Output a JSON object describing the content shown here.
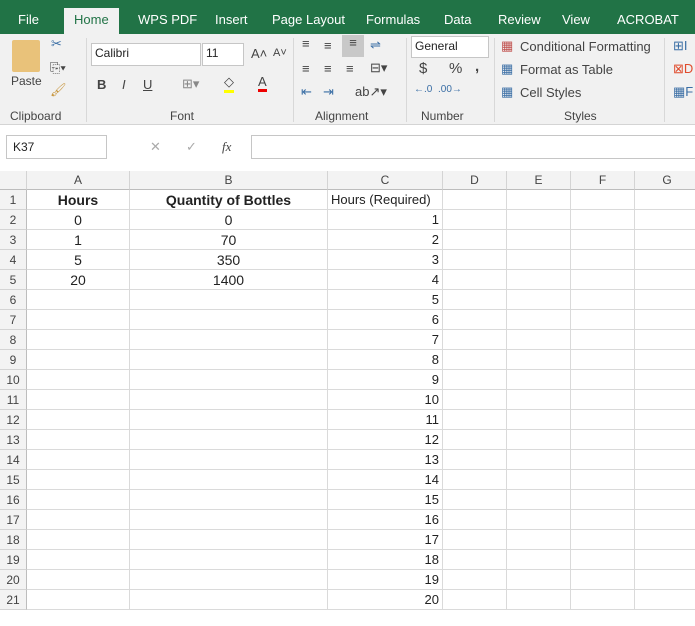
{
  "tabs": [
    "File",
    "Home",
    "WPS PDF",
    "Insert",
    "Page Layout",
    "Formulas",
    "Data",
    "Review",
    "View",
    "ACROBAT"
  ],
  "ribbon": {
    "paste": "Paste",
    "font_name": "Calibri",
    "font_size": "11",
    "bold": "B",
    "italic": "I",
    "underline": "U",
    "number_format": "General",
    "currency": "$",
    "percent": "%",
    "comma": ",",
    "cond_format": "Conditional Formatting",
    "format_table": "Format as Table",
    "cell_styles": "Cell Styles",
    "groups": [
      "Clipboard",
      "Font",
      "Alignment",
      "Number",
      "Styles"
    ]
  },
  "formula_bar": {
    "name_box": "K37",
    "fx": "fx",
    "value": ""
  },
  "columns": [
    "A",
    "B",
    "C",
    "D",
    "E",
    "F",
    "G"
  ],
  "rows": [
    [
      "Hours",
      "Quantity of Bottles",
      "Hours (Required)"
    ],
    [
      "0",
      "0",
      "1"
    ],
    [
      "1",
      "70",
      "2"
    ],
    [
      "5",
      "350",
      "3"
    ],
    [
      "20",
      "1400",
      "4"
    ],
    [
      "",
      "",
      "5"
    ],
    [
      "",
      "",
      "6"
    ],
    [
      "",
      "",
      "7"
    ],
    [
      "",
      "",
      "8"
    ],
    [
      "",
      "",
      "9"
    ],
    [
      "",
      "",
      "10"
    ],
    [
      "",
      "",
      "11"
    ],
    [
      "",
      "",
      "12"
    ],
    [
      "",
      "",
      "13"
    ],
    [
      "",
      "",
      "14"
    ],
    [
      "",
      "",
      "15"
    ],
    [
      "",
      "",
      "16"
    ],
    [
      "",
      "",
      "17"
    ],
    [
      "",
      "",
      "18"
    ],
    [
      "",
      "",
      "19"
    ],
    [
      "",
      "",
      "20"
    ]
  ]
}
